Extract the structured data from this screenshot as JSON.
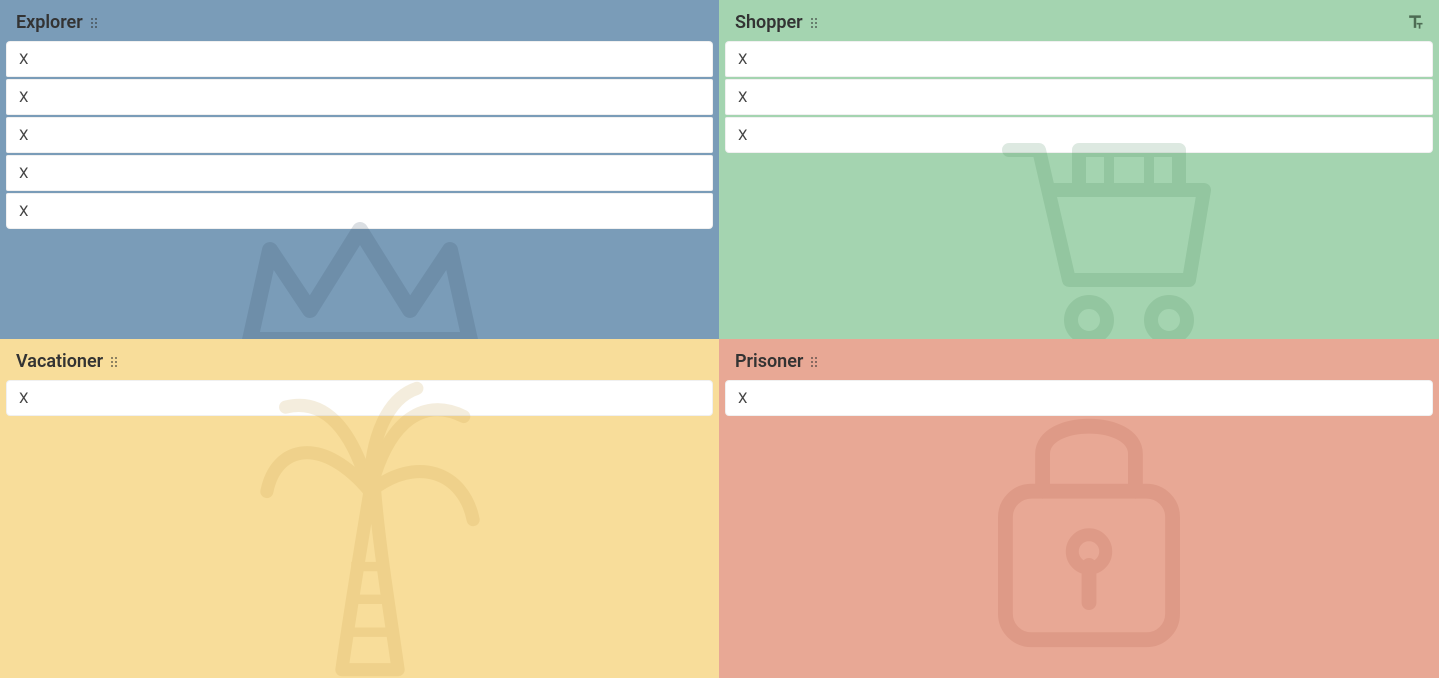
{
  "quadrants": {
    "explorer": {
      "title": "Explorer",
      "color": "#7a9cb8",
      "icon": "crown-icon",
      "cards": [
        {
          "label": "X"
        },
        {
          "label": "X"
        },
        {
          "label": "X"
        },
        {
          "label": "X"
        },
        {
          "label": "X"
        }
      ]
    },
    "shopper": {
      "title": "Shopper",
      "color": "#a4d4b0",
      "icon": "shopping-cart-icon",
      "has_text_tool": true,
      "cards": [
        {
          "label": "X"
        },
        {
          "label": "X"
        },
        {
          "label": "X"
        }
      ]
    },
    "vacationer": {
      "title": "Vacationer",
      "color": "#f8dd9a",
      "icon": "palm-tree-icon",
      "cards": [
        {
          "label": "X"
        }
      ]
    },
    "prisoner": {
      "title": "Prisoner",
      "color": "#e8a895",
      "icon": "lock-icon",
      "cards": [
        {
          "label": "X"
        }
      ]
    }
  }
}
